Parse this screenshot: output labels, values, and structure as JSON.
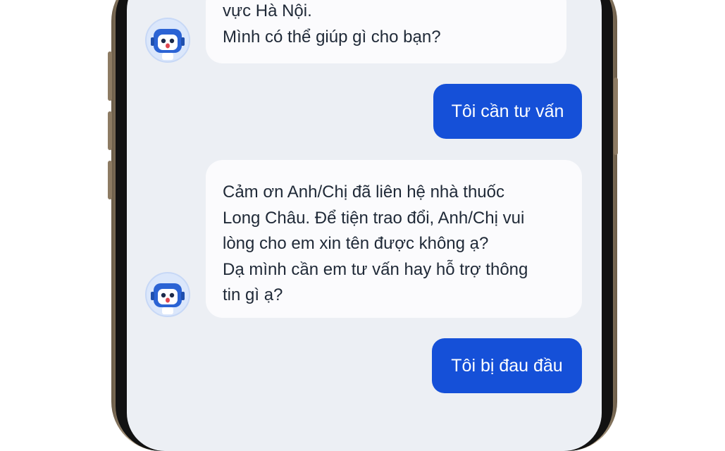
{
  "chat": {
    "messages": [
      {
        "sender": "bot",
        "lines": [
          "vực Hà Nội.",
          "Mình có thể giúp gì cho bạn?"
        ]
      },
      {
        "sender": "user",
        "text": "Tôi cần tư vấn"
      },
      {
        "sender": "bot",
        "lines": [
          "Cảm ơn Anh/Chị đã liên hệ nhà thuốc",
          "Long Châu. Để tiện trao đổi, Anh/Chị vui",
          "lòng cho em xin tên được không ạ?",
          "Dạ mình cần em tư vấn hay hỗ trợ thông",
          "tin gì ạ?"
        ]
      },
      {
        "sender": "user",
        "text": "Tôi bị đau đầu"
      }
    ]
  },
  "colors": {
    "screen_background": "#eceff4",
    "bot_bubble": "#fbfbfd",
    "user_bubble": "#1550d8",
    "user_text": "#ffffff",
    "bot_text": "#1f2937",
    "phone_frame": "#8d7b63"
  },
  "icons": {
    "bot_avatar": "robot-mascot-icon"
  }
}
